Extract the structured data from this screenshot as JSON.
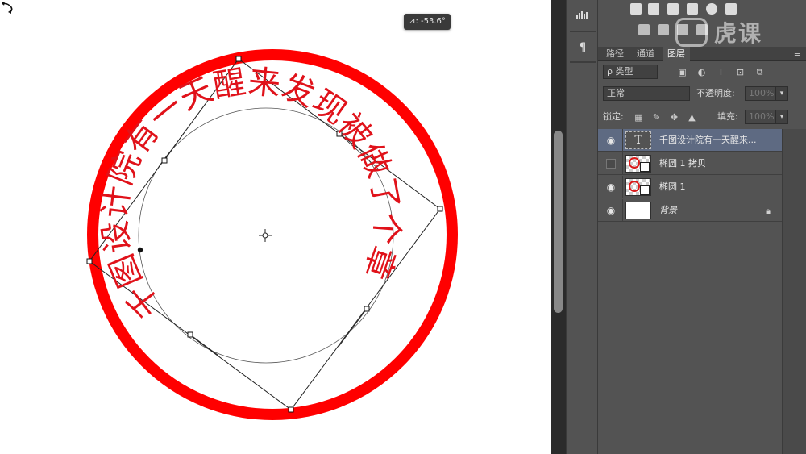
{
  "canvas": {
    "angle_readout": "⊿: -53.6°",
    "stamp_text": "千图设计院有一天醒来发现被做了个章",
    "colors": {
      "ring": "#ff0000",
      "text": "#e0121a",
      "path": "#333333"
    }
  },
  "dock": {
    "icons": [
      "histogram-icon",
      "paragraph-icon"
    ],
    "paragraph_glyph": "¶"
  },
  "adjustments": {
    "icons": [
      "levels-icon",
      "balance-icon",
      "curves-icon",
      "camera-icon",
      "color-circles-icon",
      "grid-icon",
      "brush-icon",
      "gradient-icon",
      "square-icon",
      "image-icon"
    ]
  },
  "watermark": {
    "text": "虎课"
  },
  "tabs": [
    {
      "label": "路径"
    },
    {
      "label": "通道"
    },
    {
      "label": "图层"
    }
  ],
  "layers_panel": {
    "filter_label": "ρ 类型",
    "blend_mode": "正常",
    "opacity_label": "不透明度:",
    "opacity_value": "100%",
    "lock_label": "锁定:",
    "fill_label": "填充:",
    "fill_value": "100%"
  },
  "layers": [
    {
      "name": "千图设计院有一天醒来...",
      "visible": true,
      "kind": "text",
      "selected": true
    },
    {
      "name": "椭圆 1 拷贝",
      "visible": false,
      "kind": "shape",
      "selected": false
    },
    {
      "name": "椭圆 1",
      "visible": true,
      "kind": "shape",
      "selected": false
    },
    {
      "name": "背景",
      "visible": true,
      "kind": "background",
      "selected": false,
      "locked": true
    }
  ]
}
